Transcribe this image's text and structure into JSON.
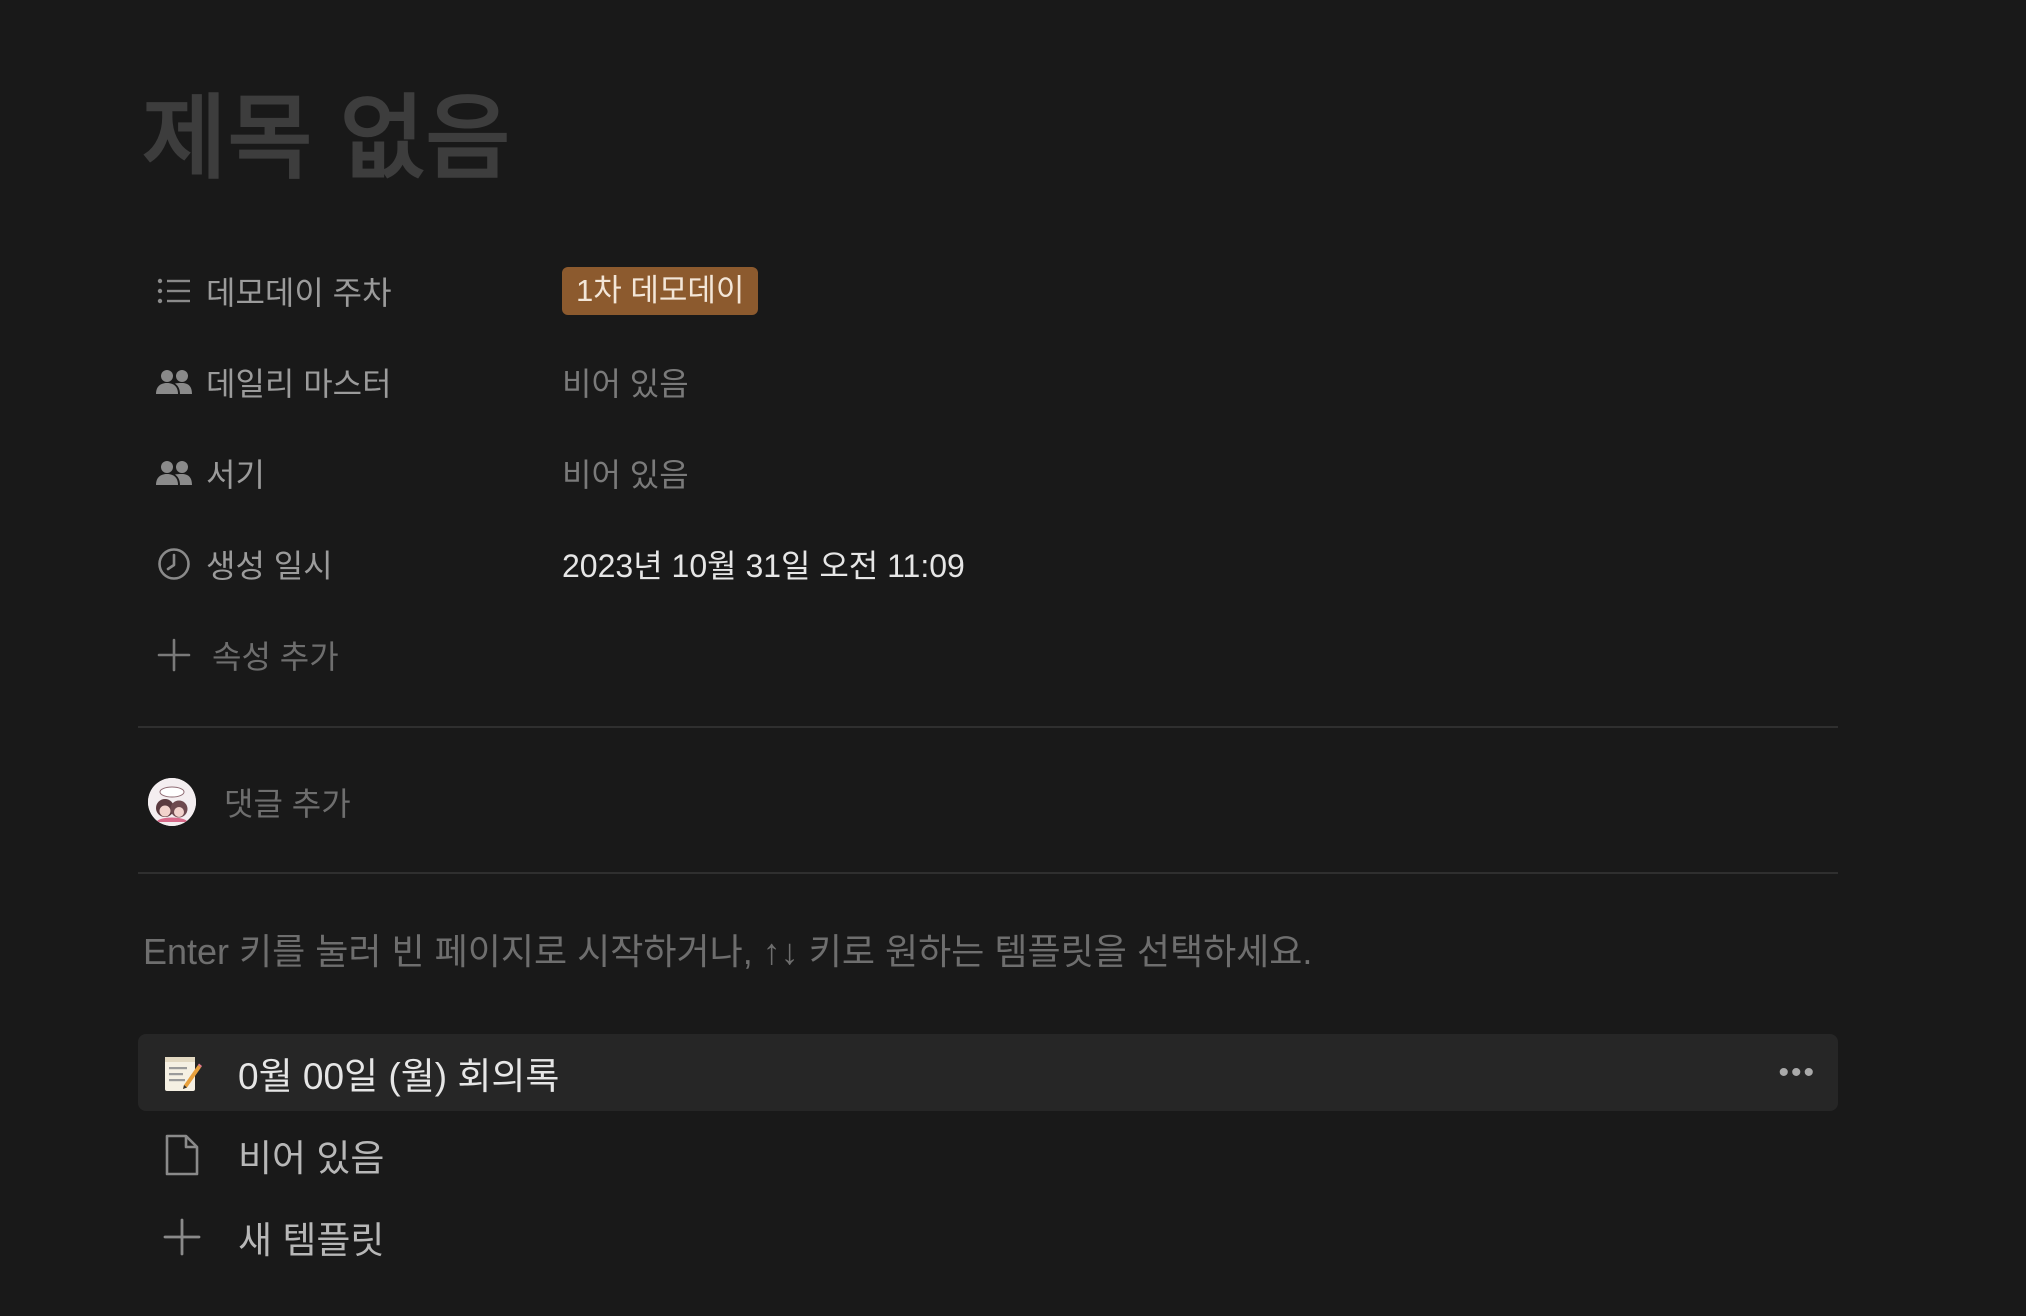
{
  "title": "제목 없음",
  "properties": [
    {
      "icon": "list-icon",
      "key": "데모데이 주차",
      "value": "1차 데모데이",
      "value_type": "tag",
      "tag_color": "#8c5a2e"
    },
    {
      "icon": "people-icon",
      "key": "데일리 마스터",
      "value": "비어 있음",
      "value_type": "empty"
    },
    {
      "icon": "people-icon",
      "key": "서기",
      "value": "비어 있음",
      "value_type": "empty"
    },
    {
      "icon": "clock-icon",
      "key": "생성 일시",
      "value": "2023년 10월 31일 오전 11:09",
      "value_type": "text"
    }
  ],
  "add_property_label": "속성 추가",
  "comment_placeholder": "댓글 추가",
  "template_hint": "Enter 키를 눌러 빈 페이지로 시작하거나, ↑↓ 키로 원하는 템플릿을 선택하세요.",
  "templates": [
    {
      "icon": "memo-icon",
      "emoji": "📝",
      "label": "0월 00일 (월) 회의록",
      "active": true
    },
    {
      "icon": "page-icon",
      "label": "비어 있음",
      "active": false
    },
    {
      "icon": "plus-icon",
      "label": "새 템플릿",
      "active": false
    }
  ],
  "more_label": "•••"
}
